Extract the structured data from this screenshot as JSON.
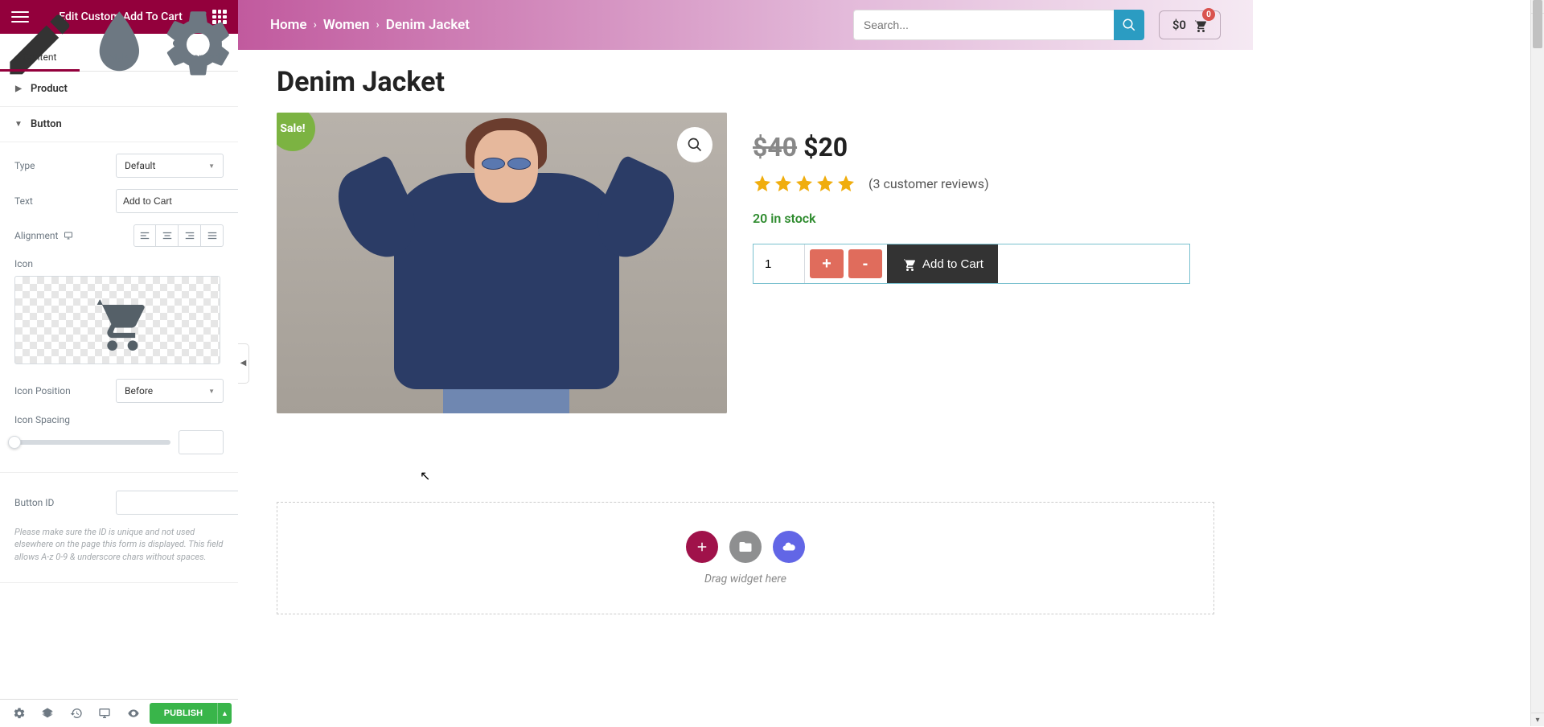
{
  "panel": {
    "title": "Edit Custom Add To Cart",
    "tabs": {
      "content": "Content",
      "style": "Style",
      "advanced": "Advanced"
    },
    "sections": {
      "product": "Product",
      "button": "Button"
    },
    "controls": {
      "type_label": "Type",
      "type_value": "Default",
      "text_label": "Text",
      "text_value": "Add to Cart",
      "alignment_label": "Alignment",
      "icon_label": "Icon",
      "icon_position_label": "Icon Position",
      "icon_position_value": "Before",
      "icon_spacing_label": "Icon Spacing",
      "button_id_label": "Button ID",
      "button_id_value": "",
      "button_id_help": "Please make sure the ID is unique and not used elsewhere on the page this form is displayed. This field allows A-z 0-9 & underscore chars without spaces."
    },
    "footer": {
      "publish": "PUBLISH"
    }
  },
  "preview": {
    "breadcrumb": [
      "Home",
      "Women",
      "Denim Jacket"
    ],
    "search_placeholder": "Search...",
    "cart_total": "$0",
    "cart_count": "0",
    "product": {
      "title": "Denim Jacket",
      "sale_badge": "Sale!",
      "price_old": "$40",
      "price_new": "$20",
      "reviews_text": "(3 customer reviews)",
      "stock_text": "20 in stock",
      "qty": "1",
      "plus": "+",
      "minus": "-",
      "add_to_cart": "Add to Cart"
    },
    "dropzone": "Drag widget here"
  }
}
